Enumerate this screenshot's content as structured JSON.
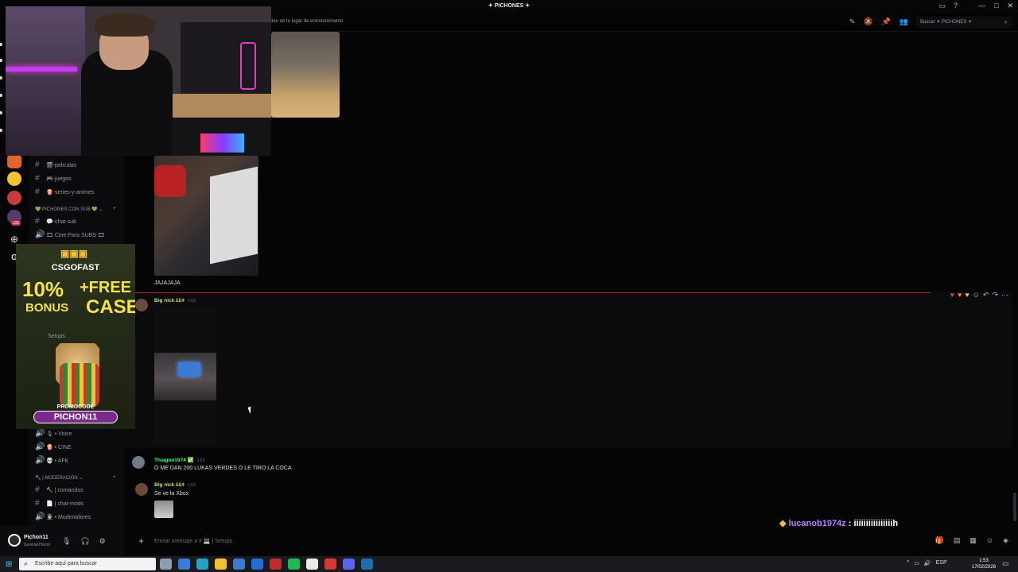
{
  "window": {
    "title": "✦ PICHONES ✦",
    "controls": [
      "—",
      "□",
      "✕"
    ]
  },
  "header": {
    "channel_description": "deo de tu lugar de entretenimiento",
    "search_placeholder": "Buscar ✦ PICHONES ✦"
  },
  "sidebar": {
    "channels": [
      {
        "label": "🎬-peliculas",
        "type": "text"
      },
      {
        "label": "🎮-juegos",
        "type": "text"
      },
      {
        "label": "🍿-series-y-animes",
        "type": "text"
      }
    ],
    "category_sub": "💚 PICHONES CON SUB 💚",
    "sub_channels": [
      {
        "label": "💬-chat-sub",
        "type": "text"
      },
      {
        "label": "🎞 Cine Para SUBS 🎞",
        "type": "voice"
      }
    ],
    "hidden_channel": "Setups",
    "voice_channels": [
      {
        "label": "🎙 • Voice"
      },
      {
        "label": "🍿 • CINE"
      },
      {
        "label": "💀 • AFK"
      }
    ],
    "category_mod": "🔨 | MODERACIÓN",
    "mod_channels": [
      {
        "label": "🔨 | comandos"
      },
      {
        "label": "📄 | chat-mods"
      },
      {
        "label": "👮 • Moderadores"
      }
    ],
    "rail_badge": "121"
  },
  "user": {
    "name": "Pichon11",
    "status": "Survival Horror"
  },
  "ad": {
    "brand": "CSGOFAST",
    "bonus": "10%",
    "bonus_label": "BONUS",
    "plus": "+FREE",
    "case": "CASE",
    "promo_label": "PROMOCODE",
    "code": "PICHON11"
  },
  "messages": [
    {
      "type": "text",
      "text": "JAJAJAJA"
    },
    {
      "author": "Big nick ££¢",
      "time": "1:53",
      "color": "#c1e34a"
    },
    {
      "author": "Thiagoo1974 ✅",
      "time": "1:53",
      "color": "#57f287",
      "text": "O ME DAN 200 LUKAS VERDES O LE TIRO LA COCA"
    },
    {
      "author": "Big nick ££¢",
      "time": "1:53",
      "color": "#c1e34a",
      "text": "Se ve la Xbox"
    }
  ],
  "stream_chat": {
    "user": "lucanob1974z",
    "sep": " : ",
    "text": "iiiiiiiiiiiiiiiih",
    "user_color": "#b77bff"
  },
  "composer": {
    "placeholder": "Enviar mensaje a # 💻 | Setups"
  },
  "taskbar": {
    "search_placeholder": "Escribe aquí para buscar",
    "lang": "ESP",
    "time": "1:53",
    "date": "17/02/2026"
  }
}
